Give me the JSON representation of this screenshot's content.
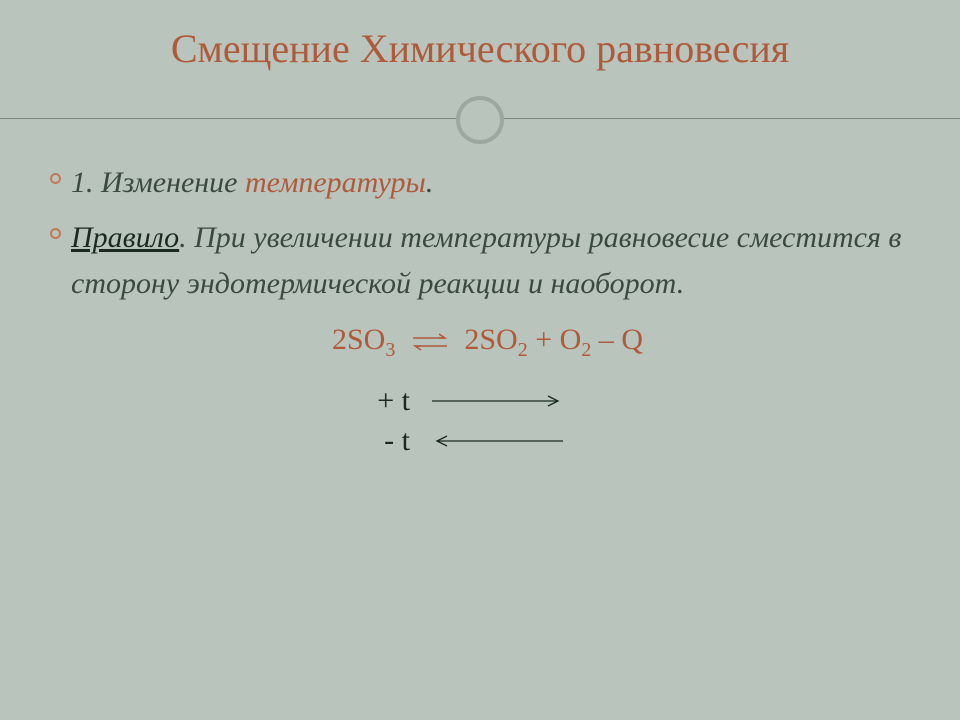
{
  "title": "Смещение Химического равновесия",
  "bullets": {
    "item1_prefix": "1. Изменение ",
    "item1_accent": "температуры",
    "item1_suffix": ".",
    "item2_rule": "Правило",
    "item2_text": ". При увеличении температуры равновесие сместится в сторону эндотермической реакции и наоборот."
  },
  "equation": {
    "lhs_coef": "2SO",
    "lhs_sub": "3",
    "rhs_part1_coef": "2SO",
    "rhs_part1_sub": "2",
    "plus": " + ",
    "rhs_part2": "O",
    "rhs_part2_sub": "2",
    "tail": " – Q"
  },
  "temp": {
    "plus": "+ t",
    "minus": "- t"
  }
}
